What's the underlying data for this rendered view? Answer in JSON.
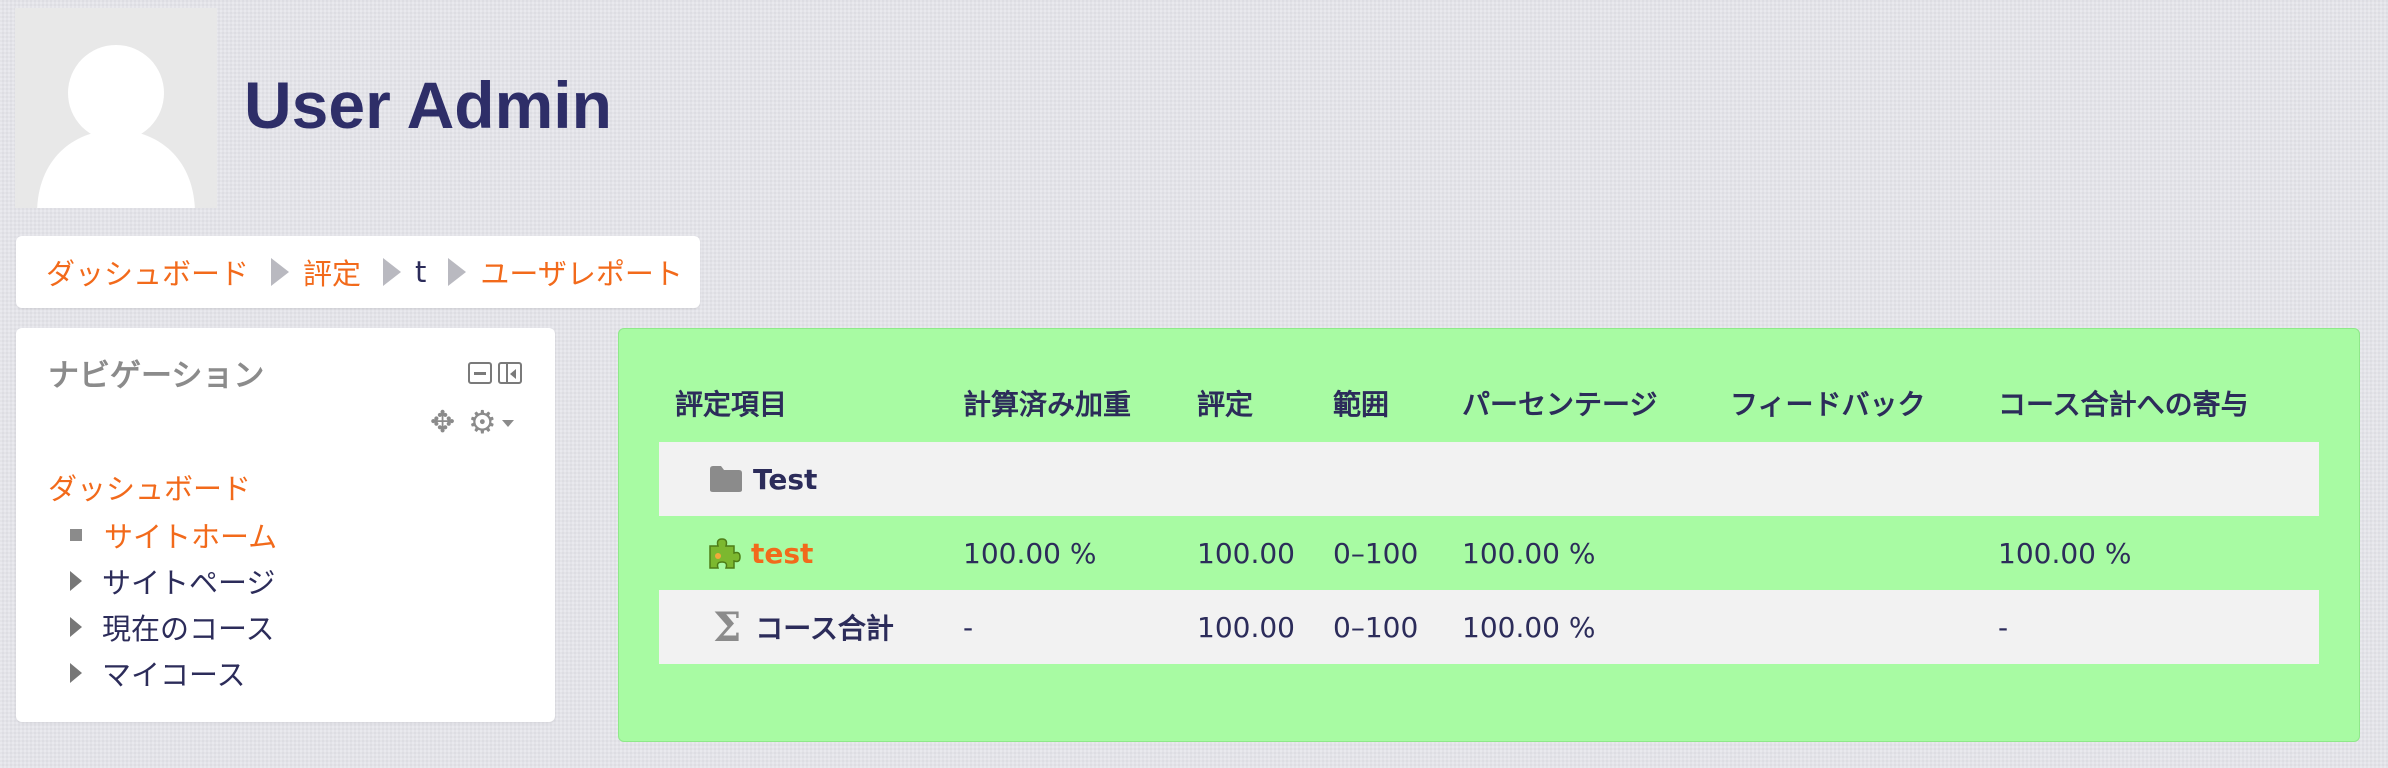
{
  "user": {
    "name": "User Admin",
    "avatar_alt": "User Admin のプロファイル画像"
  },
  "breadcrumb": [
    {
      "label": "ダッシュボード",
      "link": true
    },
    {
      "label": "評定",
      "link": true
    },
    {
      "label": "t",
      "link": false
    },
    {
      "label": "ユーザレポート",
      "link": true
    }
  ],
  "navigation": {
    "title": "ナビゲーション",
    "dashboard": "ダッシュボード",
    "items": [
      {
        "label": "サイトホーム",
        "type": "home"
      },
      {
        "label": "サイトページ",
        "type": "expandable"
      },
      {
        "label": "現在のコース",
        "type": "expandable"
      },
      {
        "label": "マイコース",
        "type": "expandable"
      }
    ]
  },
  "report": {
    "headers": [
      "評定項目",
      "計算済み加重",
      "評定",
      "範囲",
      "パーセンテージ",
      "フィードバック",
      "コース合計への寄与"
    ],
    "category": {
      "name": "Test"
    },
    "item": {
      "name": "test",
      "weight": "100.00 %",
      "grade": "100.00",
      "range": "0–100",
      "percentage": "100.00 %",
      "feedback": "",
      "contribution": "100.00 %"
    },
    "total": {
      "name": "コース合計",
      "weight": "-",
      "grade": "100.00",
      "range": "0–100",
      "percentage": "100.00 %",
      "feedback": "",
      "contribution": "-"
    }
  },
  "colors": {
    "link": "#f26a1b",
    "text": "#2c2c5a",
    "panel": "#a8fba3",
    "row_grey": "#f2f2f2"
  }
}
